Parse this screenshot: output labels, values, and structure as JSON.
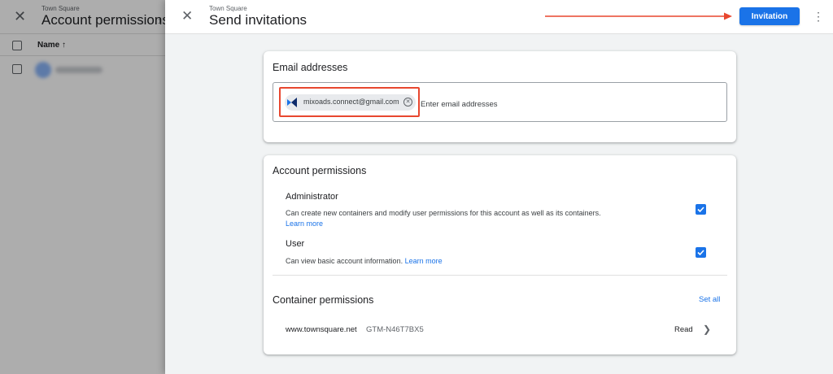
{
  "background": {
    "subtitle": "Town Square",
    "title": "Account permissions",
    "count": "1",
    "column_name": "Name",
    "sort_icon": "↑"
  },
  "sheet": {
    "subtitle": "Town Square",
    "title": "Send invitations",
    "close_icon": "✕",
    "primary_button": "Invitation",
    "more_icon": "⋮",
    "accent_color": "#1a73e8",
    "annotation_color": "#e8472f"
  },
  "email": {
    "title": "Email addresses",
    "chip_email": "mixoads.connect@gmail.com",
    "placeholder": "Enter email addresses"
  },
  "account_permissions": {
    "title": "Account permissions",
    "items": [
      {
        "name": "Administrator",
        "description": "Can create new containers and modify user permissions for this account as well as its containers.",
        "link": "Learn more",
        "checked": true
      },
      {
        "name": "User",
        "description": "Can view basic account information.",
        "link": "Learn more",
        "checked": true
      }
    ]
  },
  "container_permissions": {
    "title": "Container permissions",
    "set_all": "Set all",
    "rows": [
      {
        "name": "www.townsquare.net",
        "id": "GTM-N46T7BX5",
        "access": "Read"
      }
    ]
  }
}
